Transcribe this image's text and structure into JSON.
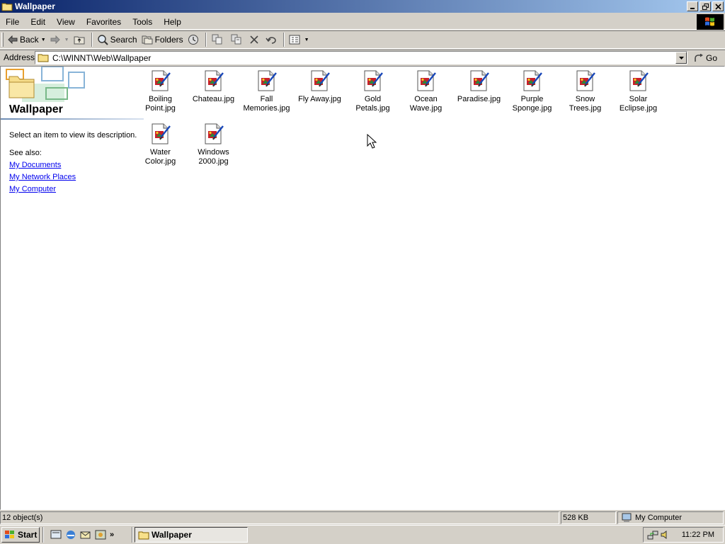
{
  "window": {
    "title": "Wallpaper"
  },
  "menu": [
    "File",
    "Edit",
    "View",
    "Favorites",
    "Tools",
    "Help"
  ],
  "toolbar": {
    "back": "Back",
    "search": "Search",
    "folders": "Folders"
  },
  "address": {
    "label": "Address",
    "path": "C:\\WINNT\\Web\\Wallpaper",
    "go": "Go"
  },
  "left_pane": {
    "folder_title": "Wallpaper",
    "description": "Select an item to view its description.",
    "see_also": "See also:",
    "links": [
      "My Documents",
      "My Network Places",
      "My Computer"
    ]
  },
  "files": [
    [
      "Boiling",
      "Point.jpg"
    ],
    [
      "Chateau.jpg"
    ],
    [
      "Fall",
      "Memories.jpg"
    ],
    [
      "Fly Away.jpg"
    ],
    [
      "Gold",
      "Petals.jpg"
    ],
    [
      "Ocean",
      "Wave.jpg"
    ],
    [
      "Paradise.jpg"
    ],
    [
      "Purple",
      "Sponge.jpg"
    ],
    [
      "Snow",
      "Trees.jpg"
    ],
    [
      "Solar",
      "Eclipse.jpg"
    ],
    [
      "Water",
      "Color.jpg"
    ],
    [
      "Windows",
      "2000.jpg"
    ]
  ],
  "status": {
    "objects": "12 object(s)",
    "size": "528 KB",
    "zone": "My Computer"
  },
  "taskbar": {
    "start": "Start",
    "task": "Wallpaper",
    "clock": "11:22 PM"
  }
}
